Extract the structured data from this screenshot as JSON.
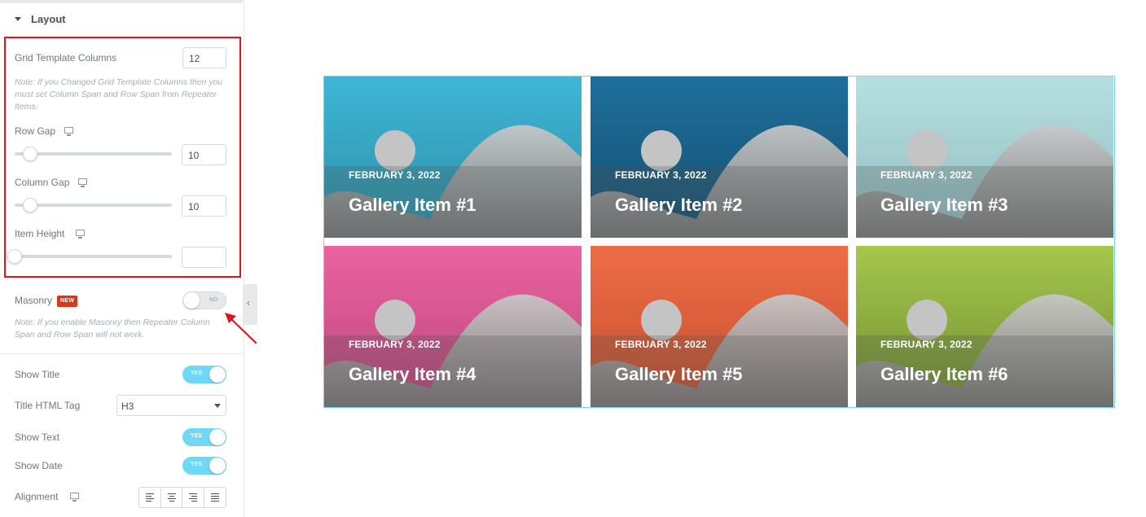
{
  "panel": {
    "section_title": "Layout",
    "grid_template_columns": {
      "label": "Grid Template Columns",
      "value": "12"
    },
    "grid_note": "Note: If you Changed Grid Template Columns then you must set Column Span and Row Span from Repeater Items.",
    "row_gap": {
      "label": "Row Gap",
      "value": "10",
      "icon": "desktop-icon"
    },
    "column_gap": {
      "label": "Column Gap",
      "value": "10",
      "icon": "desktop-icon"
    },
    "item_height": {
      "label": "Item Height",
      "value": "",
      "icon": "desktop-icon"
    },
    "masonry": {
      "label": "Masonry",
      "badge": "NEW",
      "state": "NO"
    },
    "masonry_note": "Note: If you enable Masonry then Repeater Column Span and Row Span will not work.",
    "show_title": {
      "label": "Show Title",
      "state": "YES"
    },
    "title_html_tag": {
      "label": "Title HTML Tag",
      "value": "H3"
    },
    "show_text": {
      "label": "Show Text",
      "state": "YES"
    },
    "show_date": {
      "label": "Show Date",
      "state": "YES"
    },
    "alignment": {
      "label": "Alignment"
    }
  },
  "colors": {
    "highlight_border": "#e0141e",
    "toggle_on": "#71d7f7",
    "badge_new": "#d3391a"
  },
  "gallery": {
    "items": [
      {
        "date": "FEBRUARY 3, 2022",
        "title": "Gallery Item #1",
        "color_top": "#3fb6d6",
        "color_bottom": "#2a8fa6"
      },
      {
        "date": "FEBRUARY 3, 2022",
        "title": "Gallery Item #2",
        "color_top": "#1e6e9c",
        "color_bottom": "#15506f"
      },
      {
        "date": "FEBRUARY 3, 2022",
        "title": "Gallery Item #3",
        "color_top": "#b6dfe0",
        "color_bottom": "#8fbcc0"
      },
      {
        "date": "FEBRUARY 3, 2022",
        "title": "Gallery Item #4",
        "color_top": "#ec63a2",
        "color_bottom": "#b8467a"
      },
      {
        "date": "FEBRUARY 3, 2022",
        "title": "Gallery Item #5",
        "color_top": "#ee6d46",
        "color_bottom": "#c44f2e"
      },
      {
        "date": "FEBRUARY 3, 2022",
        "title": "Gallery Item #6",
        "color_top": "#a6c64e",
        "color_bottom": "#6f8f30"
      }
    ]
  }
}
